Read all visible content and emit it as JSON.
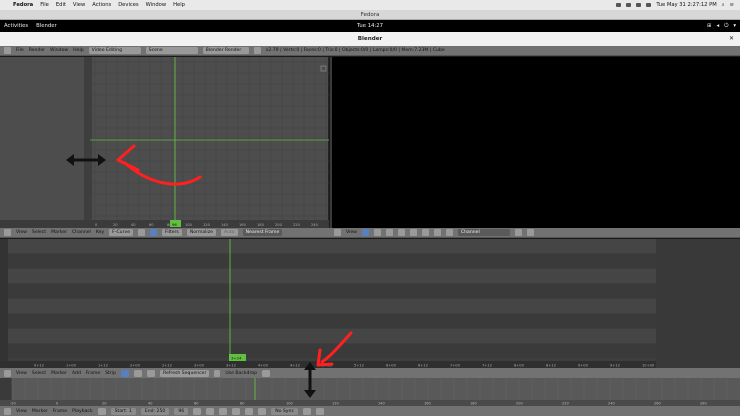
{
  "mac": {
    "fedora": "Fedora",
    "menu": [
      "File",
      "Edit",
      "View",
      "Actions",
      "Devices",
      "Window",
      "Help"
    ],
    "datetime": "Tue May 31  2:27:12 PM"
  },
  "vm_title": "Fedora",
  "gnome": {
    "activities": "Activities",
    "app": "Blender",
    "clock": "Tue 14:27"
  },
  "blender_title": "Blender",
  "info": {
    "menu": [
      "File",
      "Render",
      "Window",
      "Help"
    ],
    "layout": "Video Editing",
    "scene": "Scene",
    "engine": "Blender Render",
    "stats": "v2.79 | Verts:0 | Faces:0 | Tris:0 | Objects:0/0 | Lamps:0/0 | Mem:7.23M | Cube"
  },
  "graph_header": {
    "menu": [
      "View",
      "Select",
      "Marker",
      "Channel",
      "Key"
    ],
    "mode": "F-Curve",
    "filters": "Filters",
    "normalize": "Normalize",
    "auto": "Auto",
    "interp": "Nearest Frame"
  },
  "seq_preview_header": {
    "view": "View",
    "channel": "Channel"
  },
  "sequencer_header": {
    "menu": [
      "View",
      "Select",
      "Marker",
      "Add",
      "Frame",
      "Strip"
    ],
    "refresh": "Refresh Sequencer",
    "backdrop": "Use Backdrop"
  },
  "timeline_header": {
    "menu": [
      "View",
      "Marker",
      "Frame",
      "Playback"
    ],
    "start_label": "Start:",
    "start": "1",
    "end_label": "End:",
    "end": "250",
    "current": "96",
    "sync": "No Sync"
  },
  "graph_frame_badge": "96",
  "seq_frame_badge": "3+24",
  "seq_ticks": [
    "0+12",
    "1+00",
    "1+12",
    "2+00",
    "2+12",
    "3+00",
    "3+12",
    "4+00",
    "4+12",
    "5+00",
    "5+12",
    "6+00",
    "6+12",
    "7+00",
    "7+12",
    "8+00",
    "8+12",
    "9+00",
    "9+12",
    "10+00"
  ],
  "graph_ticks": [
    "0",
    "20",
    "40",
    "60",
    "80",
    "100",
    "120",
    "140",
    "160",
    "180",
    "200",
    "220",
    "240"
  ],
  "timeline_ticks": [
    "-20",
    "0",
    "20",
    "40",
    "60",
    "80",
    "100",
    "120",
    "140",
    "160",
    "180",
    "200",
    "220",
    "240",
    "260",
    "280"
  ],
  "colors": {
    "playhead": "#60c040",
    "arrow": "#ff2020",
    "accent": "#5680c2"
  }
}
